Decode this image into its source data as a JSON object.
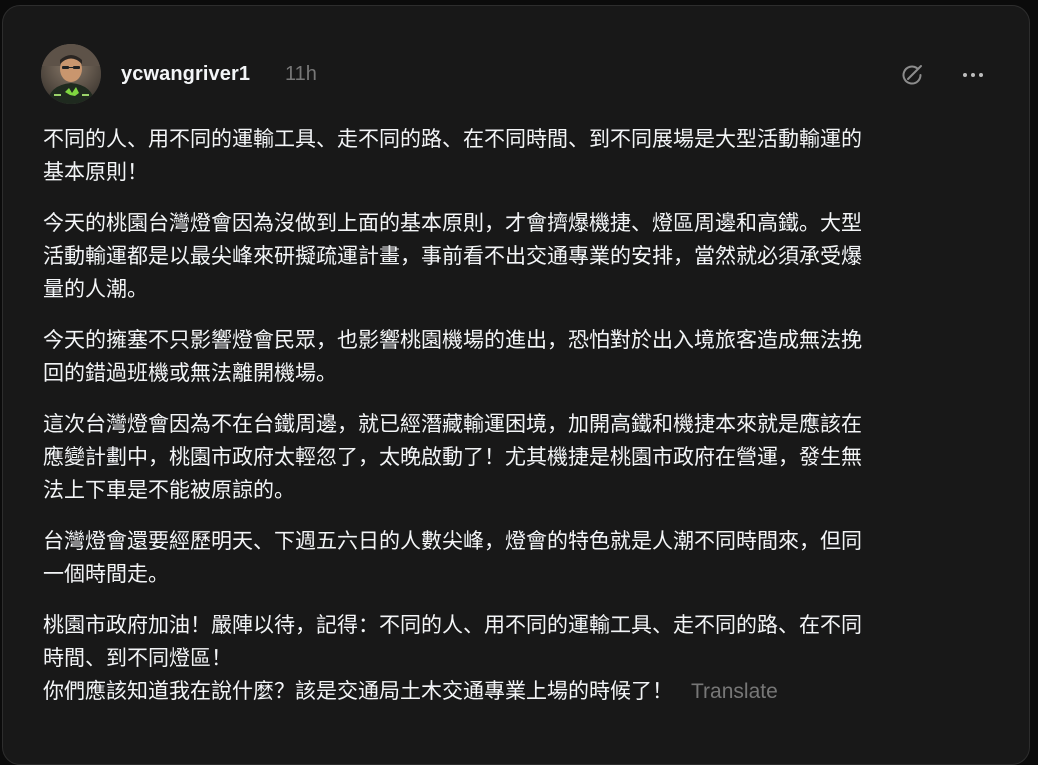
{
  "post": {
    "author": "ycwangriver1",
    "time": "11h",
    "icons": {
      "mute": "mute-icon",
      "more": "more-icon"
    },
    "paragraphs": [
      "不同的人、用不同的運輸工具、走不同的路、在不同時間、到不同展場是大型活動輸運的\n基本原則！",
      "今天的桃園台灣燈會因為沒做到上面的基本原則，才會擠爆機捷、燈區周邊和高鐵。大型\n活動輸運都是以最尖峰來研擬疏運計畫，事前看不出交通專業的安排，當然就必須承受爆\n量的人潮。",
      "今天的擁塞不只影響燈會民眾，也影響桃園機場的進出，恐怕對於出入境旅客造成無法挽\n回的錯過班機或無法離開機場。",
      "這次台灣燈會因為不在台鐵周邊，就已經潛藏輸運困境，加開高鐵和機捷本來就是應該在\n應變計劃中，桃園市政府太輕忽了，太晚啟動了！尤其機捷是桃園市政府在營運，發生無\n法上下車是不能被原諒的。",
      "台灣燈會還要經歷明天、下週五六日的人數尖峰，燈會的特色就是人潮不同時間來，但同\n一個時間走。",
      "桃園市政府加油！嚴陣以待，記得：不同的人、用不同的運輸工具、走不同的路、在不同\n時間、到不同燈區！\n你們應該知道我在說什麼？該是交通局土木交通專業上場的時候了！"
    ],
    "translate_label": "Translate"
  }
}
